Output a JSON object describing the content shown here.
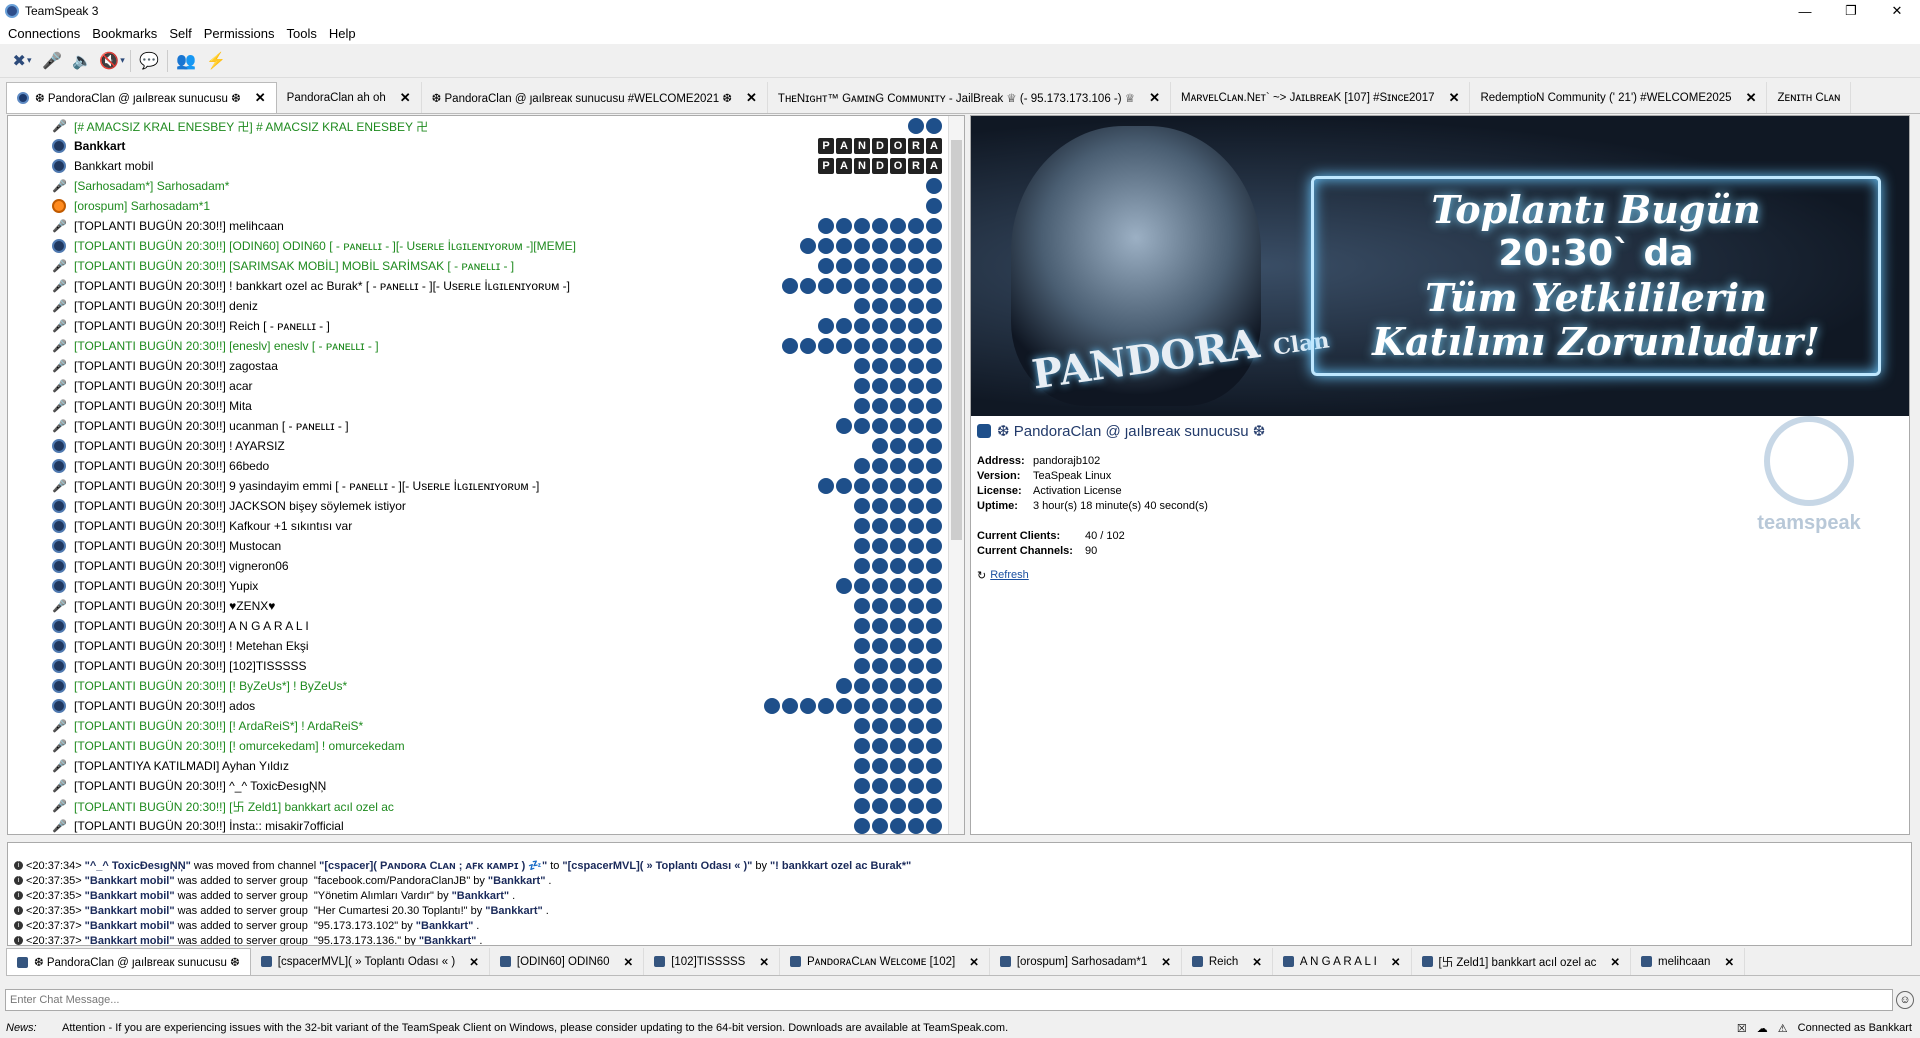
{
  "window": {
    "title": "TeamSpeak 3",
    "min": "—",
    "max": "❐",
    "close": "✕"
  },
  "menu": [
    "Connections",
    "Bookmarks",
    "Self",
    "Permissions",
    "Tools",
    "Help"
  ],
  "server_tabs": [
    {
      "label": "❆ PandoraClan @ ȷaılвreaк sunucusu ❆"
    },
    {
      "label": "PandoraClan ah oh"
    },
    {
      "label": "❆ PandoraClan @ ȷaılвreaк sunucusu #WELCOME2021 ❆"
    },
    {
      "label": "TʜᴇNɪɢʜᴛ™ GᴀᴍɪɴG Cᴏᴍᴍᴜɴɪᴛʏ - JailBreak ♕ (- 95.173.173.106 -) ♕"
    },
    {
      "label": "MᴀʀᴠᴇʟCʟᴀɴ.Nᴇᴛ` ~> JᴀɪʟʙʀᴇᴀK [107] #Sɪɴᴄᴇ2017"
    },
    {
      "label": "RedemptioN Community (' 21') #WELCOME2025"
    },
    {
      "label": "Zᴇɴɪᴛʜ Cʟᴀɴ"
    }
  ],
  "tree_rows": [
    {
      "name": "[#      AMACSIZ KRAL ENESBEY 卍] #      AMACSIZ KRAL ENESBEY 卍",
      "color": "green",
      "bold": false,
      "status": "mic",
      "badges": 2
    },
    {
      "name": "Bankkart",
      "color": "black",
      "bold": true,
      "status": "dot",
      "badges": 0,
      "letters": "PANDORA"
    },
    {
      "name": "Bankkart mobil",
      "color": "black",
      "bold": false,
      "status": "dot",
      "badges": 0,
      "letters": "PANDORA"
    },
    {
      "name": "[Sarhosadam*] Sarhosadam*",
      "color": "green",
      "bold": false,
      "status": "mic",
      "badges": 1
    },
    {
      "name": "[orospum] Sarhosadam*1",
      "color": "green",
      "bold": false,
      "status": "orange",
      "badges": 1
    },
    {
      "name": "[TOPLANTI BUGÜN  20:30!!] melihcaan",
      "color": "black",
      "bold": false,
      "status": "mic",
      "badges": 7
    },
    {
      "name": "[TOPLANTI BUGÜN  20:30!!] [ODIN60] ODIN60 [ - ᴘᴀɴᴇʟʟɪ - ][- Usᴇʀʟᴇ İʟɢɪʟᴇɴɪʏᴏʀᴜᴍ -][MEME]",
      "color": "green",
      "bold": false,
      "status": "dot",
      "badges": 8
    },
    {
      "name": "[TOPLANTI BUGÜN  20:30!!] [SARIMSAK MOBİL] MOBİL SARİMSAK [ - ᴘᴀɴᴇʟʟɪ - ]",
      "color": "green",
      "bold": false,
      "status": "mic",
      "badges": 7
    },
    {
      "name": "[TOPLANTI BUGÜN  20:30!!] ! bankkart ozel ac    Burak* [ - ᴘᴀɴᴇʟʟɪ - ][- Usᴇʀʟᴇ İʟɢɪʟᴇɴɪʏᴏʀᴜᴍ -]",
      "color": "black",
      "bold": false,
      "status": "mic",
      "badges": 9
    },
    {
      "name": "[TOPLANTI BUGÜN  20:30!!] deniz",
      "color": "black",
      "bold": false,
      "status": "mic",
      "badges": 5
    },
    {
      "name": "[TOPLANTI BUGÜN  20:30!!] Reich [ - ᴘᴀɴᴇʟʟɪ - ]",
      "color": "black",
      "bold": false,
      "status": "mic",
      "badges": 7
    },
    {
      "name": "[TOPLANTI BUGÜN  20:30!!] [eneslv] eneslv [ - ᴘᴀɴᴇʟʟɪ - ]",
      "color": "green",
      "bold": false,
      "status": "mic",
      "badges": 9
    },
    {
      "name": "[TOPLANTI BUGÜN  20:30!!] zagostaa",
      "color": "black",
      "bold": false,
      "status": "mic",
      "badges": 5
    },
    {
      "name": "[TOPLANTI BUGÜN  20:30!!] acar",
      "color": "black",
      "bold": false,
      "status": "mic",
      "badges": 5
    },
    {
      "name": "[TOPLANTI BUGÜN  20:30!!] Mita",
      "color": "black",
      "bold": false,
      "status": "mic",
      "badges": 5
    },
    {
      "name": "[TOPLANTI BUGÜN  20:30!!] ucanman [ - ᴘᴀɴᴇʟʟɪ - ]",
      "color": "black",
      "bold": false,
      "status": "mic",
      "badges": 6
    },
    {
      "name": "[TOPLANTI BUGÜN  20:30!!] !                     AYARSIZ",
      "color": "black",
      "bold": false,
      "status": "dot",
      "badges": 4
    },
    {
      "name": "[TOPLANTI BUGÜN  20:30!!] 66bedo",
      "color": "black",
      "bold": false,
      "status": "dot",
      "badges": 5
    },
    {
      "name": "[TOPLANTI BUGÜN  20:30!!] 9 yasindayim emmi [ - ᴘᴀɴᴇʟʟɪ - ][- Usᴇʀʟᴇ İʟɢɪʟᴇɴɪʏᴏʀᴜᴍ -]",
      "color": "black",
      "bold": false,
      "status": "mic",
      "badges": 7
    },
    {
      "name": "[TOPLANTI BUGÜN  20:30!!] JACKSON bişey söylemek istiyor",
      "color": "black",
      "bold": false,
      "status": "dot",
      "badges": 5
    },
    {
      "name": "[TOPLANTI BUGÜN  20:30!!] Kafkour +1 sıkıntısı var",
      "color": "black",
      "bold": false,
      "status": "dot",
      "badges": 5
    },
    {
      "name": "[TOPLANTI BUGÜN  20:30!!] Mustocan",
      "color": "black",
      "bold": false,
      "status": "dot",
      "badges": 5
    },
    {
      "name": "[TOPLANTI BUGÜN  20:30!!] vigneron06",
      "color": "black",
      "bold": false,
      "status": "dot",
      "badges": 5
    },
    {
      "name": "[TOPLANTI BUGÜN  20:30!!] Yupix",
      "color": "black",
      "bold": false,
      "status": "dot",
      "badges": 6
    },
    {
      "name": "[TOPLANTI BUGÜN  20:30!!] ♥ZENX♥",
      "color": "black",
      "bold": false,
      "status": "mic",
      "badges": 5
    },
    {
      "name": "[TOPLANTI BUGÜN  20:30!!]                                         A N G A R A L I",
      "color": "black",
      "bold": false,
      "status": "dot",
      "badges": 5
    },
    {
      "name": "[TOPLANTI BUGÜN  20:30!!] ! Metehan Ekşi",
      "color": "black",
      "bold": false,
      "status": "dot",
      "badges": 5
    },
    {
      "name": "[TOPLANTI BUGÜN  20:30!!] [102]TISSSSS",
      "color": "black",
      "bold": false,
      "status": "dot",
      "badges": 5
    },
    {
      "name": "[TOPLANTI BUGÜN  20:30!!] [!                 ByZeUs*] !                    ByZeUs*",
      "color": "green",
      "bold": false,
      "status": "dot",
      "badges": 6
    },
    {
      "name": "[TOPLANTI BUGÜN  20:30!!] ados",
      "color": "black",
      "bold": false,
      "status": "dot",
      "badges": 10
    },
    {
      "name": "[TOPLANTI BUGÜN  20:30!!] [!                 ArdaReiS*] !                 ArdaReiS*",
      "color": "green",
      "bold": false,
      "status": "mic",
      "badges": 5
    },
    {
      "name": "[TOPLANTI BUGÜN  20:30!!] [!                 omurcekedam] !                 omurcekedam",
      "color": "green",
      "bold": false,
      "status": "mic",
      "badges": 5
    },
    {
      "name": "[TOPLANTIYA KATILMADI] Ayhan Yıldız",
      "color": "black",
      "bold": false,
      "status": "mic",
      "badges": 5
    },
    {
      "name": "[TOPLANTI BUGÜN  20:30!!] ^_^                         ToxicĐesıgŅŅ",
      "color": "black",
      "bold": false,
      "status": "mic",
      "badges": 5
    },
    {
      "name": "[TOPLANTI BUGÜN  20:30!!] [卐        Zeld1] bankkart acıl ozel ac",
      "color": "green",
      "bold": false,
      "status": "mic",
      "badges": 5
    },
    {
      "name": "[TOPLANTI BUGÜN  20:30!!] İnsta:: misakir7official",
      "color": "black",
      "bold": false,
      "status": "mic",
      "badges": 5
    }
  ],
  "banner": {
    "logo": "PANDORA",
    "logo_sub": "Clan",
    "line1": "Toplantı Bugün",
    "line2": "20:30` da",
    "line3": "Tüm Yetkililerin",
    "line4": "Katılımı Zorunludur!"
  },
  "server_info": {
    "name": "❆ PandoraClan @ ȷaılвreaк sunucusu ❆",
    "address_label": "Address:",
    "address": "pandorajb102",
    "version_label": "Version:",
    "version": "TeaSpeak Linux",
    "license_label": "License:",
    "license": "Activation License",
    "uptime_label": "Uptime:",
    "uptime": "3 hour(s) 18 minute(s) 40 second(s)",
    "clients_label": "Current Clients:",
    "clients": "40 / 102",
    "channels_label": "Current Channels:",
    "channels": "90",
    "refresh": "Refresh",
    "brand": "teamspeak"
  },
  "log_lines": [
    {
      "time": "<20:37:34>",
      "a": "\"^_^                   ToxicĐesıgŅŅ\"",
      "t": " was moved from channel ",
      "b": "\"[cspacer]( Pᴀɴᴅᴏʀᴀ Cʟᴀɴ ; ᴀꜰᴋ ᴋᴀᴍᴘɪ ) 💤\"",
      "t2": " to ",
      "c": "\"[cspacerMVL]( » Toplantı Odası « )\"",
      "t3": " by ",
      "d": "\"! bankkart ozel ac    Burak*\""
    },
    {
      "time": "<20:37:35>",
      "a": "\"Bankkart mobil\"",
      "t": " was added to server group ",
      "b": "",
      "t2": "\"facebook.com/PandoraClanJB\" by ",
      "c": "\"Bankkart\"",
      "t3": ".",
      "d": ""
    },
    {
      "time": "<20:37:35>",
      "a": "\"Bankkart mobil\"",
      "t": " was added to server group ",
      "b": "",
      "t2": "\"Yönetim Alımları Vardır\" by ",
      "c": "\"Bankkart\"",
      "t3": ".",
      "d": ""
    },
    {
      "time": "<20:37:35>",
      "a": "\"Bankkart mobil\"",
      "t": " was added to server group ",
      "b": "",
      "t2": "\"Her Cumartesi 20.30 Toplantı!\" by ",
      "c": "\"Bankkart\"",
      "t3": ".",
      "d": ""
    },
    {
      "time": "<20:37:37>",
      "a": "\"Bankkart mobil\"",
      "t": " was added to server group ",
      "b": "",
      "t2": "\"95.173.173.102\" by ",
      "c": "\"Bankkart\"",
      "t3": ".",
      "d": ""
    },
    {
      "time": "<20:37:37>",
      "a": "\"Bankkart mobil\"",
      "t": " was added to server group ",
      "b": "",
      "t2": "\"95.173.173.136.\" by ",
      "c": "\"Bankkart\"",
      "t3": ".",
      "d": ""
    }
  ],
  "chat_tabs": [
    "❆ PandoraClan @ ȷaılвreaк sunucusu ❆",
    "[cspacerMVL]( » Toplantı Odası « )",
    "[ODIN60] ODIN60",
    "[102]TISSSSS",
    "PᴀɴᴅᴏʀᴀCʟᴀɴ Wᴇʟᴄᴏᴍᴇ [102]",
    "[orospum] Sarhosadam*1",
    "Reich",
    "A N G A R A L I",
    "[卐        Zeld1] bankkart acıl ozel ac",
    "melihcaan"
  ],
  "chat": {
    "placeholder": "Enter Chat Message..."
  },
  "status": {
    "news_label": "News:",
    "news": "Attention - If you are experiencing issues with the 32-bit variant of the TeamSpeak Client on Windows, please consider updating to the 64-bit version. Downloads are available at TeamSpeak.com.",
    "connection": "Connected as Bankkart"
  }
}
